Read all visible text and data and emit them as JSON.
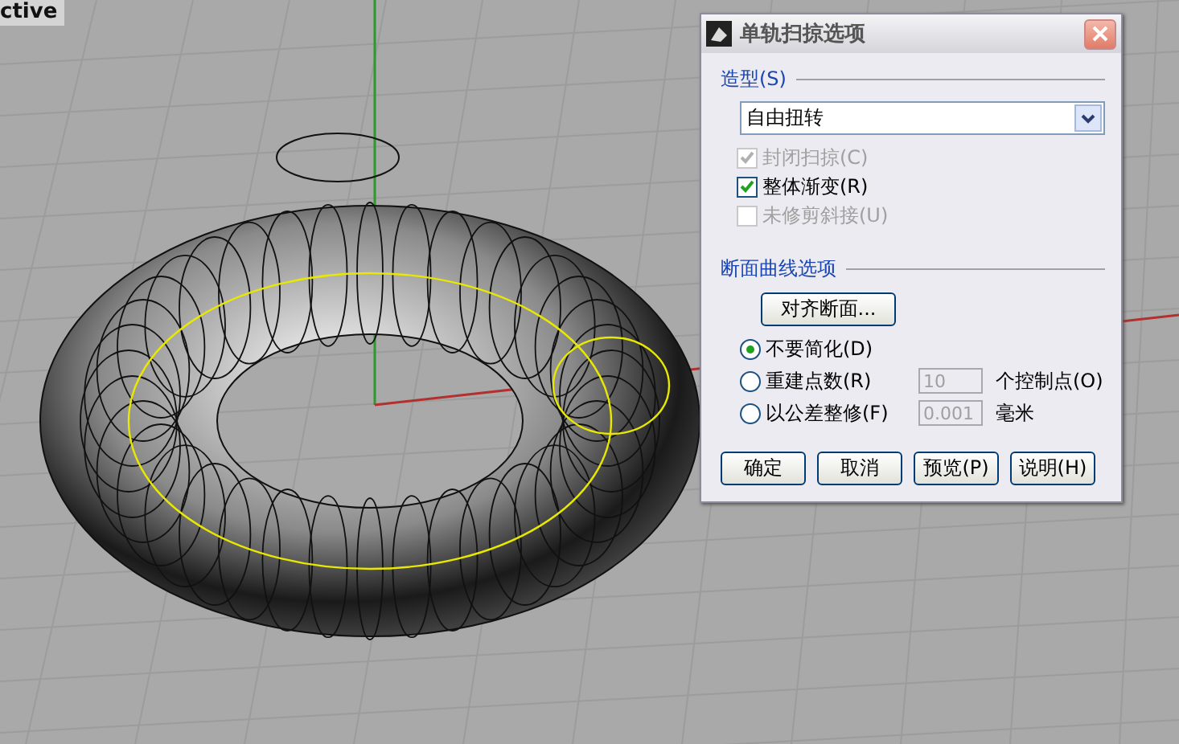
{
  "viewport": {
    "label": "ctive"
  },
  "dialog": {
    "title": "单轨扫掠选项",
    "shape_group": {
      "label": "造型(S)",
      "dropdown": {
        "value": "自由扭转"
      }
    },
    "options": [
      {
        "label": "封闭扫掠(C)",
        "checked": true,
        "disabled": true
      },
      {
        "label": "整体渐变(R)",
        "checked": true,
        "disabled": false
      },
      {
        "label": "未修剪斜接(U)",
        "checked": false,
        "disabled": true
      }
    ],
    "section_group": {
      "label": "断面曲线选项",
      "align_button": "对齐断面...",
      "radios": [
        {
          "label": "不要简化(D)",
          "selected": true
        },
        {
          "label": "重建点数(R)",
          "selected": false,
          "field": {
            "value": "10",
            "disabled": true
          },
          "unit": "个控制点(O)"
        },
        {
          "label": "以公差整修(F)",
          "selected": false,
          "field": {
            "value": "0.001",
            "disabled": true
          },
          "unit": "毫米"
        }
      ]
    },
    "buttons": [
      "确定",
      "取消",
      "预览(P)",
      "说明(H)"
    ]
  }
}
